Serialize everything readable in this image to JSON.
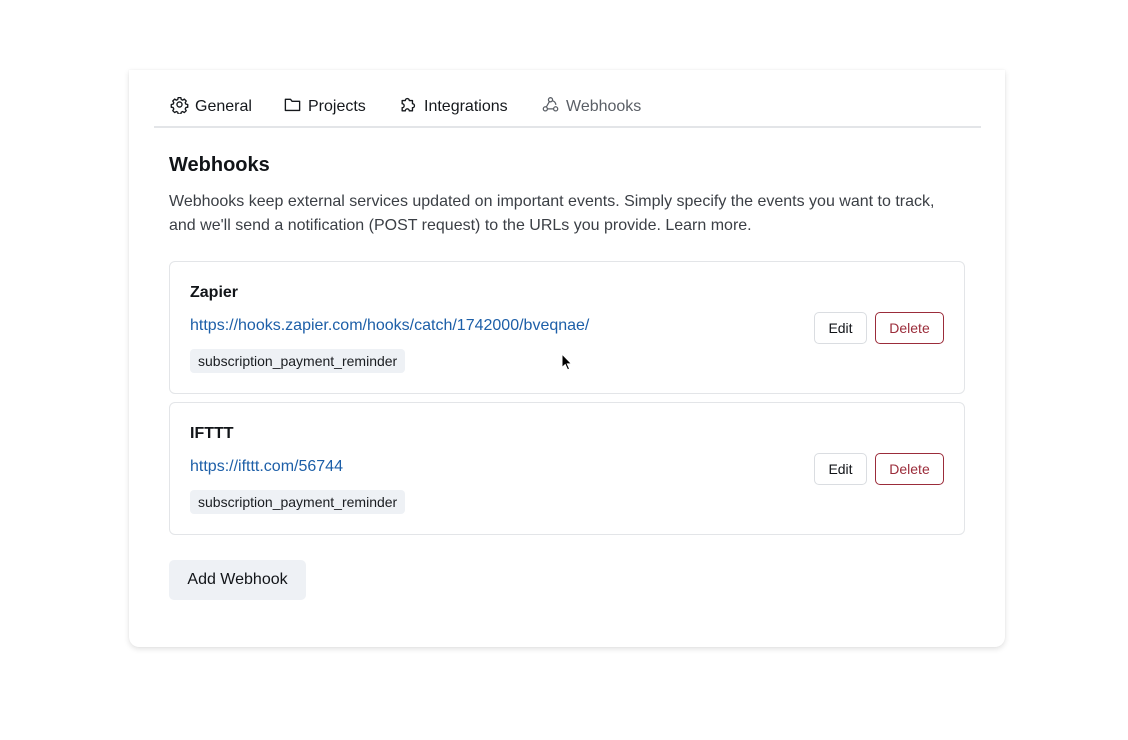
{
  "tabs": [
    {
      "label": "General",
      "icon": "gear-icon"
    },
    {
      "label": "Projects",
      "icon": "folder-icon"
    },
    {
      "label": "Integrations",
      "icon": "puzzle-icon"
    },
    {
      "label": "Webhooks",
      "icon": "webhook-icon",
      "active": true
    }
  ],
  "page": {
    "title": "Webhooks",
    "description": "Webhooks keep external services updated on important events. Simply specify the events you want to track, and we'll send a notification (POST request) to the URLs you provide. Learn more."
  },
  "webhooks": [
    {
      "name": "Zapier",
      "url": "https://hooks.zapier.com/hooks/catch/1742000/bveqnae/",
      "event": "subscription_payment_reminder",
      "edit_label": "Edit",
      "delete_label": "Delete"
    },
    {
      "name": "IFTTT",
      "url": "https://ifttt.com/56744",
      "event": "subscription_payment_reminder",
      "edit_label": "Edit",
      "delete_label": "Delete"
    }
  ],
  "add_button_label": "Add Webhook",
  "colors": {
    "link": "#1d5fa8",
    "danger": "#9b2c3a",
    "tag_bg": "#eef1f5"
  }
}
